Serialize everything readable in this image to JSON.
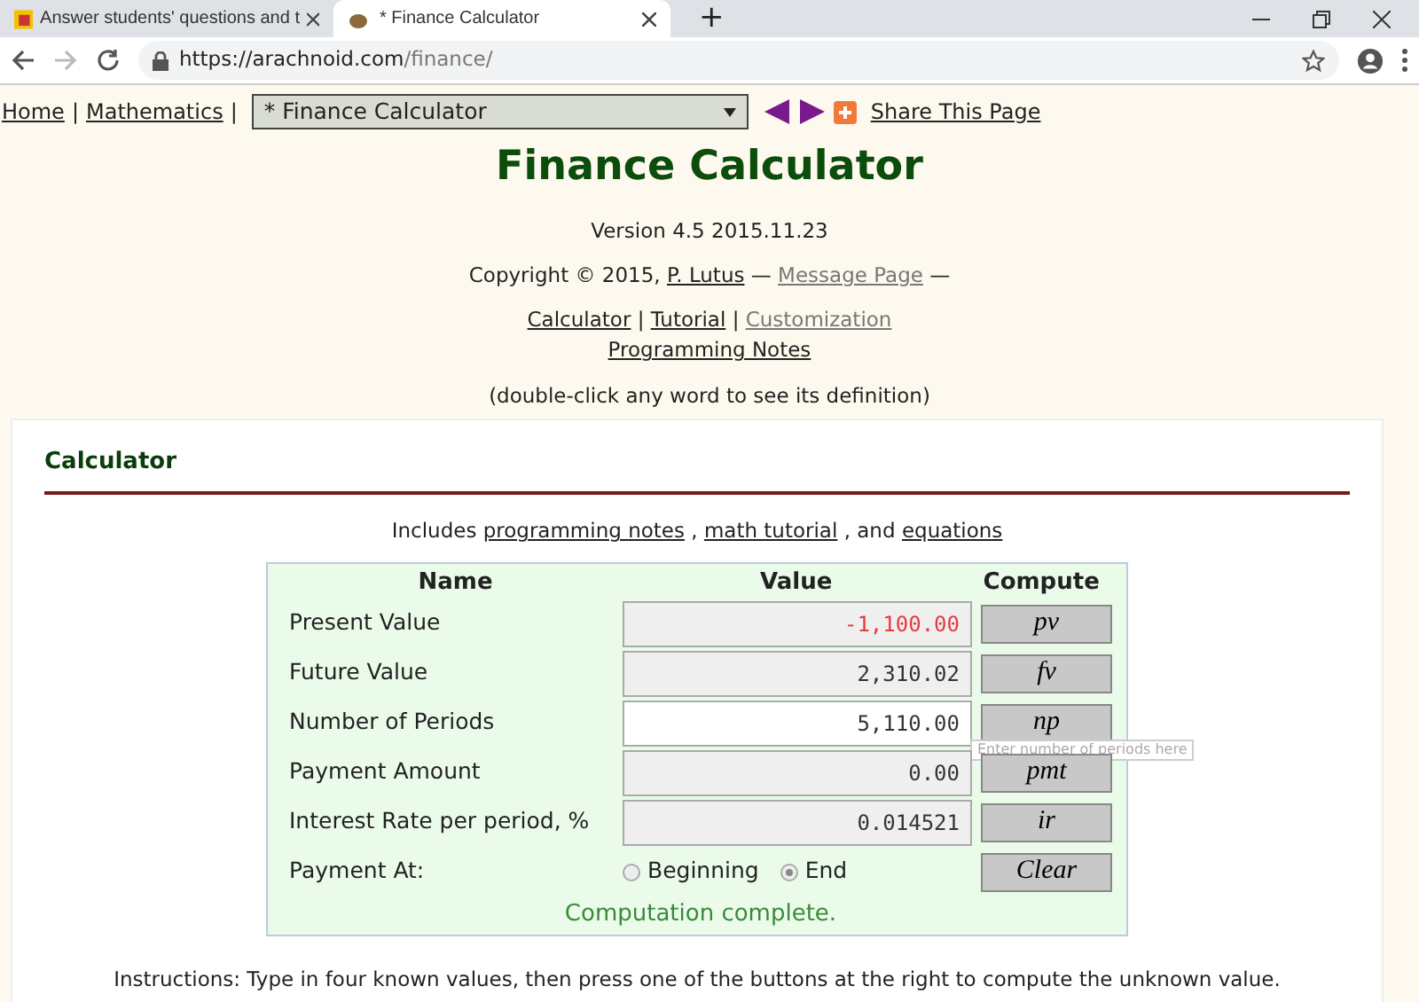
{
  "browser": {
    "tabs": [
      {
        "title": "Answer students' questions and t",
        "selected": false
      },
      {
        "title": "* Finance Calculator",
        "selected": true
      }
    ],
    "new_tab": "+",
    "url_host": "https://arachnoid.com",
    "url_path": "/finance/"
  },
  "nav": {
    "links": [
      {
        "label": "Home",
        "separator": "|"
      },
      {
        "label": "Mathematics",
        "separator": "|"
      }
    ],
    "select": "* Finance Calculator",
    "share": "Share This Page"
  },
  "header": {
    "title": "Finance Calculator",
    "version": "Version 4.5 2015.11.23",
    "copyright": "Copyright © 2015,",
    "author": "P. Lutus",
    "dash_1": "—",
    "message": "Message Page",
    "dash_2": "—",
    "separators": [
      "|",
      "|"
    ],
    "links": [
      {
        "label": "Calculator",
        "visited": false
      },
      {
        "label": "Tutorial",
        "visited": false
      },
      {
        "label": "Customization",
        "visited": true
      }
    ],
    "notes": "Programming Notes",
    "hint": "(double-click any word to see its definition)"
  },
  "section": {
    "title": "Calculator",
    "includes": [
      "Includes",
      "programming notes",
      ",",
      "math tutorial",
      ", and",
      "equations"
    ]
  },
  "calculator": {
    "columns": [
      "Name",
      "Value",
      "Compute"
    ],
    "rows": [
      {
        "name": "Present Value",
        "value": "-1,100.00",
        "color": "#e8393c",
        "focused": false,
        "button": "pv"
      },
      {
        "name": "Future Value",
        "value": "2,310.02",
        "color": "#333333",
        "focused": false,
        "button": "fv"
      },
      {
        "name": "Number of Periods",
        "value": "5,110.00",
        "color": "#333333",
        "focused": true,
        "button": "np"
      },
      {
        "name": "Payment Amount",
        "value": "0.00",
        "color": "#333333",
        "focused": false,
        "button": "pmt"
      },
      {
        "name": "Interest Rate per period, %",
        "value": "0.014521",
        "color": "#333333",
        "focused": false,
        "button": "ir"
      }
    ],
    "payment_label": "Payment At:",
    "payment_options": [
      {
        "label": "Beginning",
        "selected": false
      },
      {
        "label": "End",
        "selected": true
      }
    ],
    "clear": "Clear",
    "status": "Computation complete.",
    "tooltip": "Enter number of periods here"
  },
  "instructions": "Instructions: Type in four known values, then press one of the buttons at the right to compute the unknown value."
}
